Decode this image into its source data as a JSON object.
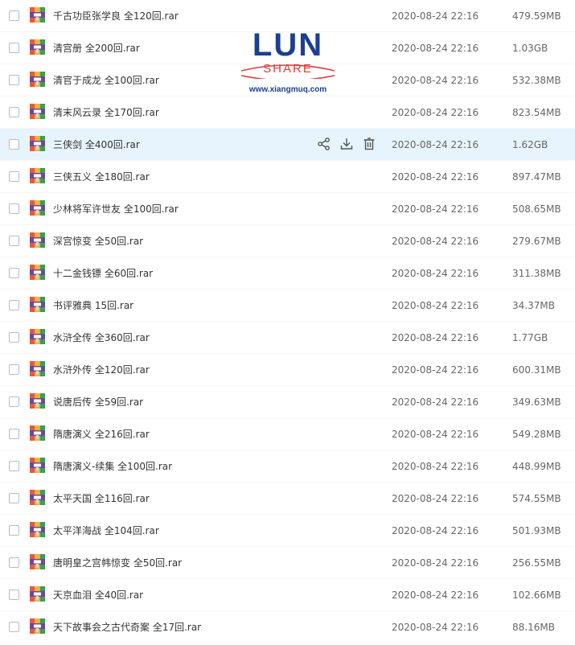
{
  "files": [
    {
      "name": "千古功臣张学良 全120回.rar",
      "date": "2020-08-24 22:16",
      "size": "479.59MB"
    },
    {
      "name": "清宫册 全200回.rar",
      "date": "2020-08-24 22:16",
      "size": "1.03GB"
    },
    {
      "name": "清官于成龙 全100回.rar",
      "date": "2020-08-24 22:16",
      "size": "532.38MB"
    },
    {
      "name": "清末风云录 全170回.rar",
      "date": "2020-08-24 22:16",
      "size": "823.54MB"
    },
    {
      "name": "三侠剑 全400回.rar",
      "date": "2020-08-24 22:16",
      "size": "1.62GB"
    },
    {
      "name": "三侠五义 全180回.rar",
      "date": "2020-08-24 22:16",
      "size": "897.47MB"
    },
    {
      "name": "少林将军许世友 全100回.rar",
      "date": "2020-08-24 22:16",
      "size": "508.65MB"
    },
    {
      "name": "深宫惊变 全50回.rar",
      "date": "2020-08-24 22:16",
      "size": "279.67MB"
    },
    {
      "name": "十二金钱镖 全60回.rar",
      "date": "2020-08-24 22:16",
      "size": "311.38MB"
    },
    {
      "name": "书评雅典 15回.rar",
      "date": "2020-08-24 22:16",
      "size": "34.37MB"
    },
    {
      "name": "水浒全传 全360回.rar",
      "date": "2020-08-24 22:16",
      "size": "1.77GB"
    },
    {
      "name": "水浒外传 全120回.rar",
      "date": "2020-08-24 22:16",
      "size": "600.31MB"
    },
    {
      "name": "说唐后传 全59回.rar",
      "date": "2020-08-24 22:16",
      "size": "349.63MB"
    },
    {
      "name": "隋唐演义 全216回.rar",
      "date": "2020-08-24 22:16",
      "size": "549.28MB"
    },
    {
      "name": "隋唐演义-续集 全100回.rar",
      "date": "2020-08-24 22:16",
      "size": "448.99MB"
    },
    {
      "name": "太平天国 全116回.rar",
      "date": "2020-08-24 22:16",
      "size": "574.55MB"
    },
    {
      "name": "太平洋海战 全104回.rar",
      "date": "2020-08-24 22:16",
      "size": "501.93MB"
    },
    {
      "name": "唐明皇之宫帏惊变 全50回.rar",
      "date": "2020-08-24 22:16",
      "size": "256.55MB"
    },
    {
      "name": "天京血泪 全40回.rar",
      "date": "2020-08-24 22:16",
      "size": "102.66MB"
    },
    {
      "name": "天下故事会之古代奇案 全17回.rar",
      "date": "2020-08-24 22:16",
      "size": "88.16MB"
    }
  ],
  "hovered_row_actions": [
    "share-icon",
    "download-icon",
    "delete-icon"
  ],
  "file_icon": "rar-archive-icon",
  "watermark": {
    "brand_top": "LUN",
    "brand_middle": "SHARE",
    "url": "www.xiangmuq.com"
  },
  "colors": {
    "hover_row_bg": "#e8f4fd",
    "watermark_blue": "#1c3f92",
    "watermark_red": "#e33a3a"
  }
}
